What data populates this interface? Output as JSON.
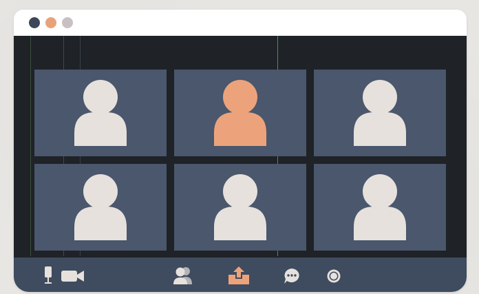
{
  "window": {
    "controls": [
      {
        "name": "close",
        "color": "#3e4758"
      },
      {
        "name": "minimize",
        "color": "#e8a27a"
      },
      {
        "name": "maximize",
        "color": "#c8c0c3"
      }
    ]
  },
  "colors": {
    "stage": "#1f2227",
    "tile": "#4a576c",
    "toolbar": "#3f4b5e",
    "avatar_default": "#e6e1dd",
    "avatar_active": "#eca37c",
    "accent": "#eca37c"
  },
  "participants": [
    {
      "id": "p1",
      "active": false,
      "icon": "user-silhouette-icon"
    },
    {
      "id": "p2",
      "active": true,
      "icon": "user-silhouette-icon"
    },
    {
      "id": "p3",
      "active": false,
      "icon": "user-silhouette-icon"
    },
    {
      "id": "p4",
      "active": false,
      "icon": "user-silhouette-icon"
    },
    {
      "id": "p5",
      "active": false,
      "icon": "user-silhouette-icon"
    },
    {
      "id": "p6",
      "active": false,
      "icon": "user-silhouette-icon"
    }
  ],
  "toolbar": {
    "buttons": [
      {
        "name": "microphone-button",
        "icon": "microphone-icon",
        "color": "#e6e1dd"
      },
      {
        "name": "camera-button",
        "icon": "video-camera-icon",
        "color": "#e6e1dd"
      },
      {
        "name": "participants-button",
        "icon": "participants-icon",
        "color": "#e6e1dd"
      },
      {
        "name": "share-screen-button",
        "icon": "share-upload-icon",
        "color": "#eca37c"
      },
      {
        "name": "chat-button",
        "icon": "chat-bubble-icon",
        "color": "#e6e1dd"
      },
      {
        "name": "record-button",
        "icon": "record-icon",
        "color": "#e6e1dd"
      }
    ]
  }
}
